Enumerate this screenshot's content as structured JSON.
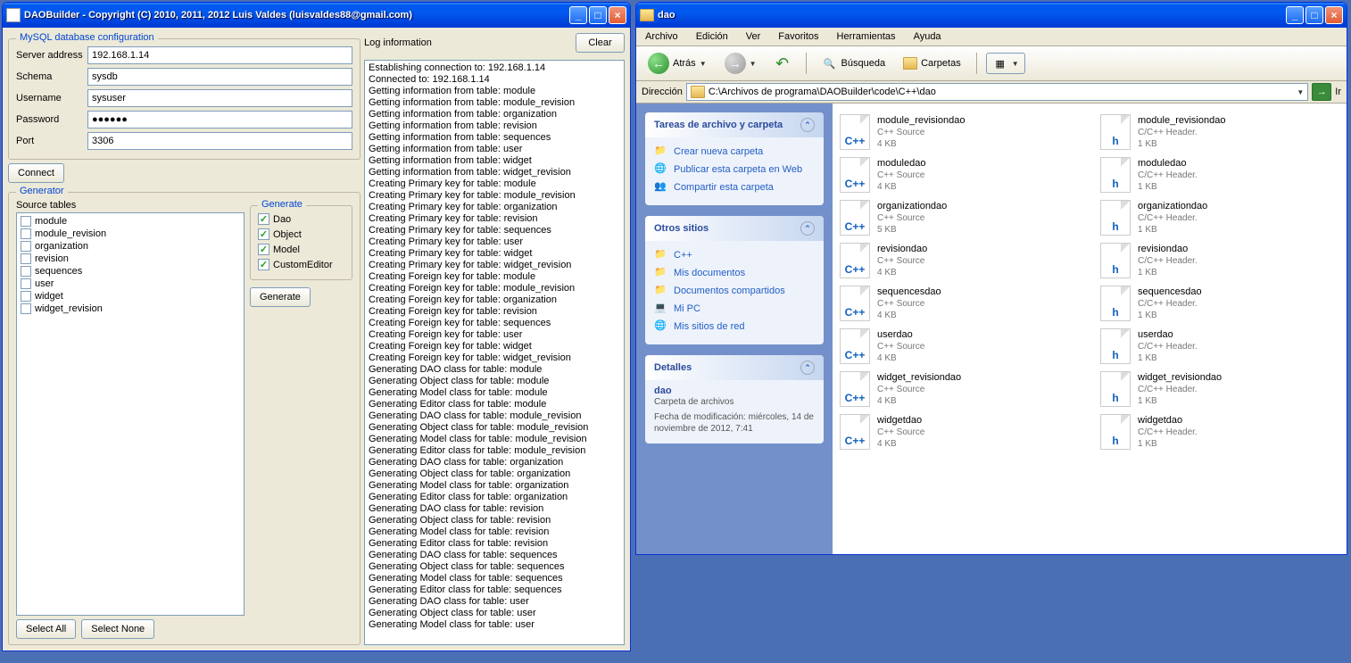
{
  "dao": {
    "title": "DAOBuilder - Copyright (C) 2010, 2011, 2012  Luis Valdes (luisvaldes88@gmail.com)",
    "mysql_group": "MySQL database configuration",
    "labels": {
      "server": "Server address",
      "schema": "Schema",
      "username": "Username",
      "password": "Password",
      "port": "Port"
    },
    "values": {
      "server": "192.168.1.14",
      "schema": "sysdb",
      "username": "sysuser",
      "password": "●●●●●●",
      "port": "3306"
    },
    "connect": "Connect",
    "generator_group": "Generator",
    "source_tables_label": "Source tables",
    "source_tables": [
      "module",
      "module_revision",
      "organization",
      "revision",
      "sequences",
      "user",
      "widget",
      "widget_revision"
    ],
    "generate_group": "Generate",
    "gen_opts": {
      "dao": "Dao",
      "object": "Object",
      "model": "Model",
      "custom": "CustomEditor"
    },
    "generate_btn": "Generate",
    "select_all": "Select All",
    "select_none": "Select None",
    "log_label": "Log information",
    "clear": "Clear",
    "log": [
      "Establishing connection to: 192.168.1.14",
      "Connected to: 192.168.1.14",
      "Getting information from table: module",
      "Getting information from table: module_revision",
      "Getting information from table: organization",
      "Getting information from table: revision",
      "Getting information from table: sequences",
      "Getting information from table: user",
      "Getting information from table: widget",
      "Getting information from table: widget_revision",
      "Creating Primary key for table: module",
      "Creating Primary key for table: module_revision",
      "Creating Primary key for table: organization",
      "Creating Primary key for table: revision",
      "Creating Primary key for table: sequences",
      "Creating Primary key for table: user",
      "Creating Primary key for table: widget",
      "Creating Primary key for table: widget_revision",
      "Creating Foreign key for table: module",
      "Creating Foreign key for table: module_revision",
      "Creating Foreign key for table: organization",
      "Creating Foreign key for table: revision",
      "Creating Foreign key for table: sequences",
      "Creating Foreign key for table: user",
      "Creating Foreign key for table: widget",
      "Creating Foreign key for table: widget_revision",
      "Generating DAO class for table: module",
      "Generating Object class for table: module",
      "Generating Model class for table: module",
      "Generating Editor class for table: module",
      "Generating DAO class for table: module_revision",
      "Generating Object class for table: module_revision",
      "Generating Model class for table: module_revision",
      "Generating Editor class for table: module_revision",
      "Generating DAO class for table: organization",
      "Generating Object class for table: organization",
      "Generating Model class for table: organization",
      "Generating Editor class for table: organization",
      "Generating DAO class for table: revision",
      "Generating Object class for table: revision",
      "Generating Model class for table: revision",
      "Generating Editor class for table: revision",
      "Generating DAO class for table: sequences",
      "Generating Object class for table: sequences",
      "Generating Model class for table: sequences",
      "Generating Editor class for table: sequences",
      "Generating DAO class for table: user",
      "Generating Object class for table: user",
      "Generating Model class for table: user"
    ]
  },
  "explorer": {
    "title": "dao",
    "menus": [
      "Archivo",
      "Edición",
      "Ver",
      "Favoritos",
      "Herramientas",
      "Ayuda"
    ],
    "toolbar": {
      "back": "Atrás",
      "search": "Búsqueda",
      "folders": "Carpetas"
    },
    "addr_label": "Dirección",
    "addr_value": "C:\\Archivos de programa\\DAOBuilder\\code\\C++\\dao",
    "go": "Ir",
    "tasks": {
      "title": "Tareas de archivo y carpeta",
      "items": [
        "Crear nueva carpeta",
        "Publicar esta carpeta en Web",
        "Compartir esta carpeta"
      ]
    },
    "places": {
      "title": "Otros sitios",
      "items": [
        "C++",
        "Mis documentos",
        "Documentos compartidos",
        "Mi PC",
        "Mis sitios de red"
      ]
    },
    "details": {
      "title": "Detalles",
      "name": "dao",
      "type": "Carpeta de archivos",
      "mod": "Fecha de modificación: miércoles, 14 de noviembre de 2012, 7:41"
    },
    "files_cpp": [
      {
        "n": "module_revisiondao",
        "t": "C++ Source",
        "s": "4 KB"
      },
      {
        "n": "moduledao",
        "t": "C++ Source",
        "s": "4 KB"
      },
      {
        "n": "organizationdao",
        "t": "C++ Source",
        "s": "5 KB"
      },
      {
        "n": "revisiondao",
        "t": "C++ Source",
        "s": "4 KB"
      },
      {
        "n": "sequencesdao",
        "t": "C++ Source",
        "s": "4 KB"
      },
      {
        "n": "userdao",
        "t": "C++ Source",
        "s": "4 KB"
      },
      {
        "n": "widget_revisiondao",
        "t": "C++ Source",
        "s": "4 KB"
      },
      {
        "n": "widgetdao",
        "t": "C++ Source",
        "s": "4 KB"
      }
    ],
    "files_h": [
      {
        "n": "module_revisiondao",
        "t": "C/C++ Header.",
        "s": "1 KB"
      },
      {
        "n": "moduledao",
        "t": "C/C++ Header.",
        "s": "1 KB"
      },
      {
        "n": "organizationdao",
        "t": "C/C++ Header.",
        "s": "1 KB"
      },
      {
        "n": "revisiondao",
        "t": "C/C++ Header.",
        "s": "1 KB"
      },
      {
        "n": "sequencesdao",
        "t": "C/C++ Header.",
        "s": "1 KB"
      },
      {
        "n": "userdao",
        "t": "C/C++ Header.",
        "s": "1 KB"
      },
      {
        "n": "widget_revisiondao",
        "t": "C/C++ Header.",
        "s": "1 KB"
      },
      {
        "n": "widgetdao",
        "t": "C/C++ Header.",
        "s": "1 KB"
      }
    ]
  }
}
